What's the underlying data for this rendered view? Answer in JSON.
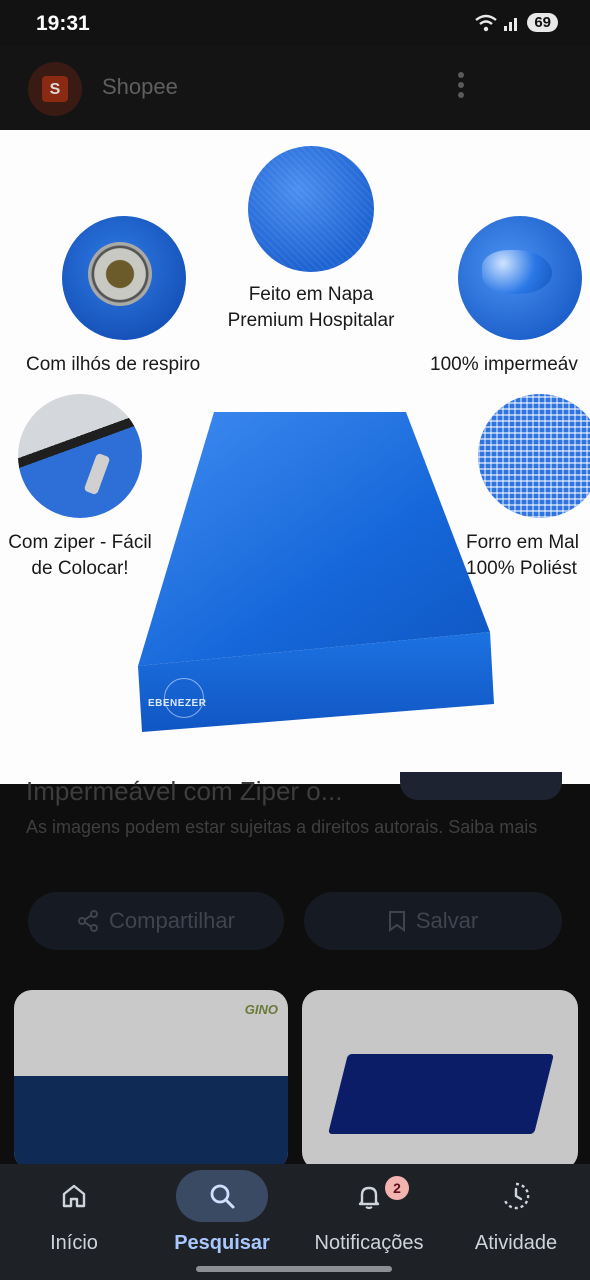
{
  "status_bar": {
    "time": "19:31",
    "battery": "69"
  },
  "app_bar": {
    "title": "Shopee",
    "logo_letter": "S"
  },
  "product_image": {
    "captions": {
      "napa_line1": "Feito em Napa",
      "napa_line2": "Premium Hospitalar",
      "ilhos": "Com ilhós de respiro",
      "impermeavel": "100% impermeáv",
      "ziper_line1": "Com ziper - Fácil",
      "ziper_line2": "de Colocar!",
      "forro_line1": "Forro em Mal",
      "forro_line2": "100% Poliést"
    },
    "brand": "EBENEZER"
  },
  "result": {
    "title": "Impermeável com Ziper o...",
    "copyright": "As imagens podem estar sujeitas a direitos autorais. Saiba mais"
  },
  "actions": {
    "share_label": "Compartilhar",
    "save_label": "Salvar"
  },
  "related": {
    "left_brand": "GINO"
  },
  "bottom_nav": {
    "items": [
      {
        "label": "Início",
        "icon": "home-icon"
      },
      {
        "label": "Pesquisar",
        "icon": "search-icon"
      },
      {
        "label": "Notificações",
        "icon": "bell-icon",
        "badge": "2"
      },
      {
        "label": "Atividade",
        "icon": "activity-icon"
      }
    ],
    "active_index": 1
  },
  "colors": {
    "accent": "#a9c7ff",
    "product_blue": "#1567d8",
    "badge": "#f3b4b0"
  }
}
